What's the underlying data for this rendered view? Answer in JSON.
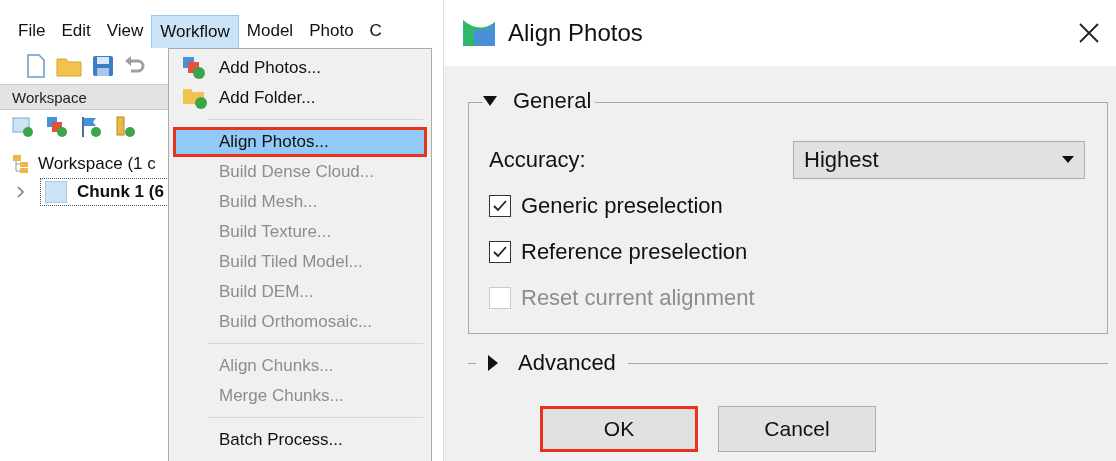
{
  "menubar": [
    {
      "label": "File",
      "selected": false
    },
    {
      "label": "Edit",
      "selected": false
    },
    {
      "label": "View",
      "selected": false
    },
    {
      "label": "Workflow",
      "selected": true
    },
    {
      "label": "Model",
      "selected": false
    },
    {
      "label": "Photo",
      "selected": false
    },
    {
      "label": "C",
      "selected": false
    }
  ],
  "workspace_panel": {
    "title": "Workspace",
    "tree": [
      {
        "label": "Workspace (1 c",
        "children": [
          {
            "label": "Chunk 1 (6",
            "expanded": false,
            "selected": true,
            "active": true
          }
        ]
      }
    ]
  },
  "workflow_menu": [
    {
      "kind": "item",
      "label": "Add Photos...",
      "disabled": false,
      "selected": false
    },
    {
      "kind": "item",
      "label": "Add Folder...",
      "disabled": false,
      "selected": false
    },
    {
      "kind": "separator"
    },
    {
      "kind": "item",
      "label": "Align Photos...",
      "disabled": false,
      "selected": true
    },
    {
      "kind": "item",
      "label": "Build Dense Cloud...",
      "disabled": true,
      "selected": false
    },
    {
      "kind": "item",
      "label": "Build Mesh...",
      "disabled": true,
      "selected": false
    },
    {
      "kind": "item",
      "label": "Build Texture...",
      "disabled": true,
      "selected": false
    },
    {
      "kind": "item",
      "label": "Build Tiled Model...",
      "disabled": true,
      "selected": false
    },
    {
      "kind": "item",
      "label": "Build DEM...",
      "disabled": true,
      "selected": false
    },
    {
      "kind": "item",
      "label": "Build Orthomosaic...",
      "disabled": true,
      "selected": false
    },
    {
      "kind": "separator"
    },
    {
      "kind": "item",
      "label": "Align Chunks...",
      "disabled": true,
      "selected": false
    },
    {
      "kind": "item",
      "label": "Merge Chunks...",
      "disabled": true,
      "selected": false
    },
    {
      "kind": "separator"
    },
    {
      "kind": "item",
      "label": "Batch Process...",
      "disabled": false,
      "selected": false
    }
  ],
  "dialog": {
    "title": "Align Photos",
    "sections": [
      {
        "title": "General",
        "expanded": true,
        "fields": [
          {
            "kind": "select",
            "label": "Accuracy:",
            "value": "Highest"
          },
          {
            "kind": "checkbox",
            "label": "Generic preselection",
            "checked": true,
            "disabled": false
          },
          {
            "kind": "checkbox",
            "label": "Reference preselection",
            "checked": true,
            "disabled": false
          },
          {
            "kind": "checkbox",
            "label": "Reset current alignment",
            "checked": false,
            "disabled": true
          }
        ]
      },
      {
        "title": "Advanced",
        "expanded": false
      }
    ],
    "buttons": [
      {
        "label": "OK",
        "highlighted": true
      },
      {
        "label": "Cancel",
        "highlighted": false
      }
    ]
  }
}
